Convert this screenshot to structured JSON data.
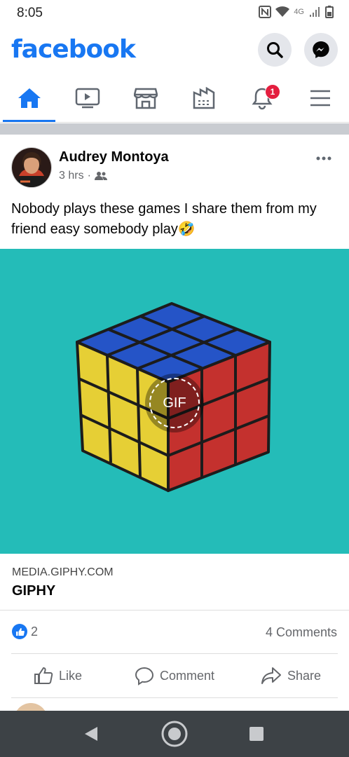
{
  "status_bar": {
    "time": "8:05",
    "network": "4G"
  },
  "header": {
    "brand": "facebook"
  },
  "tabs": [
    {
      "name": "home",
      "icon": "home-icon",
      "active": true
    },
    {
      "name": "watch",
      "icon": "video-icon"
    },
    {
      "name": "marketplace",
      "icon": "store-icon"
    },
    {
      "name": "pages",
      "icon": "building-icon"
    },
    {
      "name": "notifications",
      "icon": "bell-icon",
      "badge": "1"
    },
    {
      "name": "menu",
      "icon": "menu-icon"
    }
  ],
  "post": {
    "author": "Audrey Montoya",
    "time": "3 hrs",
    "separator": "·",
    "audience_icon": "friends-icon",
    "text": "Nobody plays these games I share them from my friend easy somebody play🤣",
    "gif_label": "GIF",
    "link": {
      "domain": "MEDIA.GIPHY.COM",
      "title": "GIPHY"
    },
    "reaction_count": "2",
    "comments": "4 Comments",
    "actions": {
      "like": "Like",
      "comment": "Comment",
      "share": "Share"
    }
  },
  "colors": {
    "brand": "#1877f2",
    "badge": "#e41e3f",
    "media_bg": "#24bcb8"
  }
}
